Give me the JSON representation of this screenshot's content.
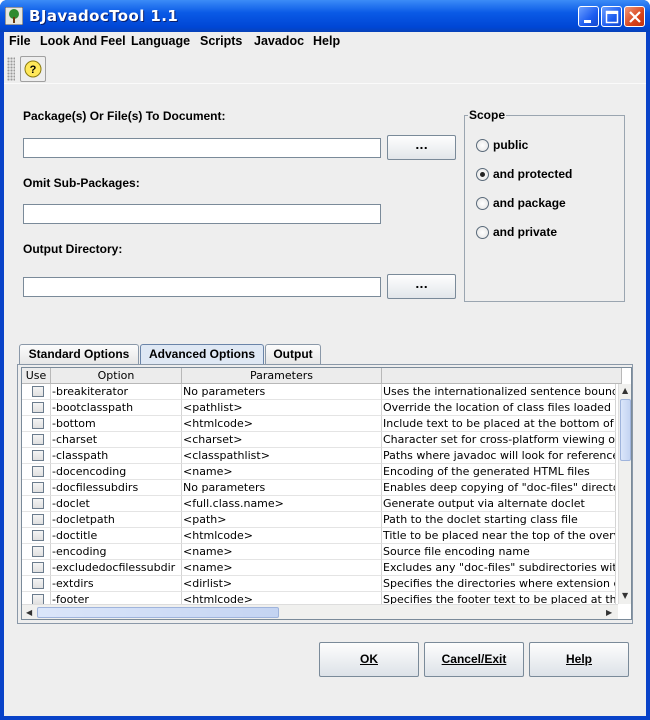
{
  "window": {
    "title": "BJavadocTool 1.1"
  },
  "menubar": [
    "File",
    "Look And Feel",
    "Language",
    "Scripts",
    "Javadoc",
    "Help"
  ],
  "toolbar": {
    "help_icon": "help-icon",
    "help_glyph": "?"
  },
  "form": {
    "packages_label": "Package(s) Or File(s) To Document:",
    "packages_value": "",
    "omit_label": "Omit Sub-Packages:",
    "omit_value": "",
    "output_label": "Output Directory:",
    "output_value": "",
    "browse_label": "..."
  },
  "scope": {
    "title": "Scope",
    "options": [
      {
        "label": "public",
        "selected": false
      },
      {
        "label": "and protected",
        "selected": true
      },
      {
        "label": "and package",
        "selected": false
      },
      {
        "label": "and private",
        "selected": false
      }
    ]
  },
  "tabs": [
    {
      "label": "Standard Options",
      "selected": false
    },
    {
      "label": "Advanced Options",
      "selected": true
    },
    {
      "label": "Output",
      "selected": false
    }
  ],
  "table": {
    "columns": [
      "Use",
      "Option",
      "Parameters",
      ""
    ],
    "rows": [
      {
        "option": "-breakiterator",
        "params": "No parameters",
        "desc": "Uses the internationalized sentence boundary"
      },
      {
        "option": "-bootclasspath",
        "params": "<pathlist>",
        "desc": "Override the location of class files loaded by"
      },
      {
        "option": "-bottom",
        "params": "<htmlcode>",
        "desc": "Include text to be placed at the bottom of each"
      },
      {
        "option": "-charset",
        "params": "<charset>",
        "desc": "Character set for cross-platform viewing of"
      },
      {
        "option": "-classpath",
        "params": "<classpathlist>",
        "desc": "Paths where javadoc will look for referenced"
      },
      {
        "option": "-docencoding",
        "params": "<name>",
        "desc": "Encoding of the generated HTML files"
      },
      {
        "option": "-docfilessubdirs",
        "params": "No parameters",
        "desc": "Enables deep copying of \"doc-files\" directories"
      },
      {
        "option": "-doclet",
        "params": "<full.class.name>",
        "desc": "Generate output via alternate doclet"
      },
      {
        "option": "-docletpath",
        "params": "<path>",
        "desc": "Path to the doclet starting class file"
      },
      {
        "option": "-doctitle",
        "params": "<htmlcode>",
        "desc": "Title to be placed near the top of the overview"
      },
      {
        "option": "-encoding",
        "params": "<name>",
        "desc": "Source file encoding name"
      },
      {
        "option": "-excludedocfilessubdir",
        "params": "<name>",
        "desc": "Excludes any \"doc-files\" subdirectories with"
      },
      {
        "option": "-extdirs",
        "params": "<dirlist>",
        "desc": "Specifies the directories where extension classes"
      },
      {
        "option": "-footer",
        "params": "<htmlcode>",
        "desc": "Specifies the footer text to be placed at the bottom"
      }
    ]
  },
  "buttons": {
    "ok": "OK",
    "cancel": "Cancel/Exit",
    "help": "Help"
  },
  "colors": {
    "titlebar": "#0a5ae6",
    "panel": "#eeeeee",
    "selected_tab": "#dfe8f4"
  }
}
